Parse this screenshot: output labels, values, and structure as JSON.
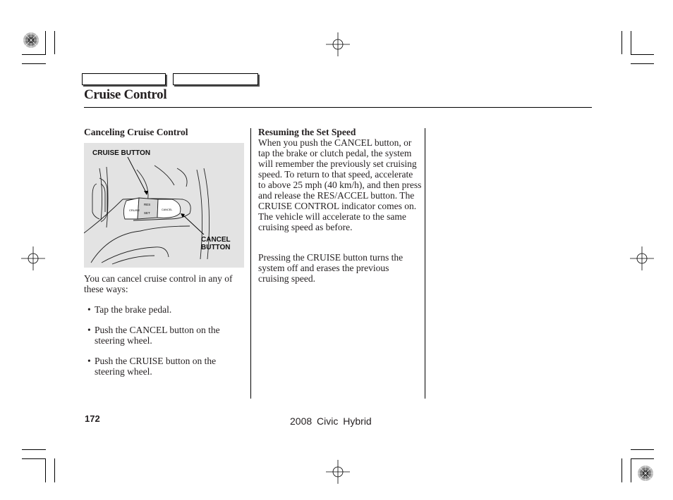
{
  "header": {
    "tab_boxes": [
      "",
      ""
    ],
    "page_title": "Cruise Control"
  },
  "left_column": {
    "heading": "Canceling Cruise Control",
    "figure": {
      "label_cruise": "CRUISE BUTTON",
      "label_cancel_line1": "CANCEL",
      "label_cancel_line2": "BUTTON",
      "switch_cruise": "CRUISE",
      "switch_res": "RES",
      "switch_set": "SET",
      "switch_cancel": "CANCEL"
    },
    "intro": "You can cancel cruise control in any of these ways:",
    "bullets": [
      "Tap the brake pedal.",
      "Push the CANCEL button on the steering wheel.",
      "Push the CRUISE button on the steering wheel."
    ]
  },
  "middle_column": {
    "heading": "Resuming the Set Speed",
    "paragraph1": "When you push the CANCEL button, or tap the brake or clutch pedal, the system will remember the previously set cruising speed. To return to that speed, accelerate to above 25 mph (40 km/h), and then press and release the RES/ACCEL button. The CRUISE CONTROL indicator comes on. The vehicle will accelerate to the same cruising speed as before.",
    "paragraph2": "Pressing the CRUISE button turns the system off and erases the previous cruising speed."
  },
  "footer": {
    "page_number": "172",
    "book_title": "2008  Civic  Hybrid"
  }
}
